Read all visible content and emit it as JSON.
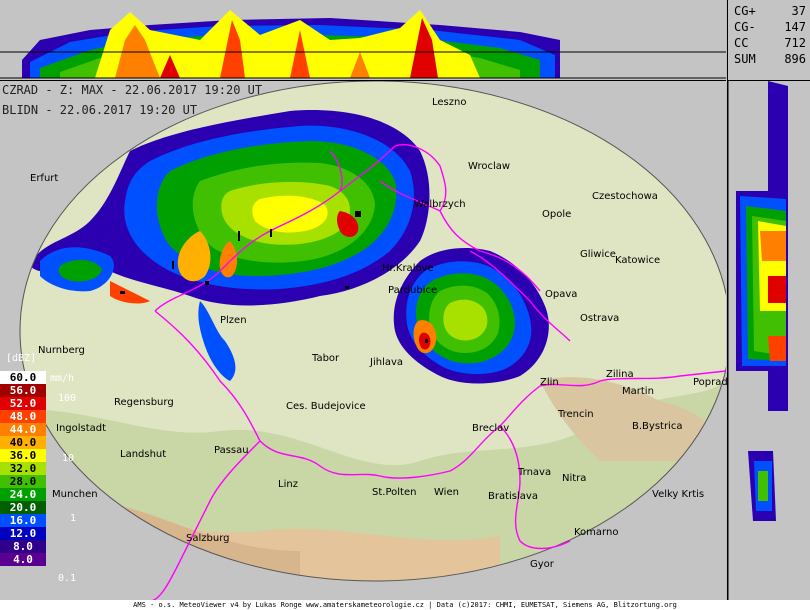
{
  "header": {
    "line1": "CZRAD - Z: MAX - 22.06.2017 19:20 UT",
    "line2": "BLIDN - 22.06.2017 19:20 UT"
  },
  "lightning_counts": [
    {
      "label": "CG+",
      "value": "37"
    },
    {
      "label": "CG-",
      "value": "147"
    },
    {
      "label": "CC",
      "value": "712"
    },
    {
      "label": "SUM",
      "value": "896"
    }
  ],
  "legend": {
    "title": "[dBZ]",
    "unit": "mm/h",
    "rows": [
      {
        "dbz": "60.0",
        "color": "#ffffff",
        "text_color": "#000000"
      },
      {
        "dbz": "56.0",
        "color": "#a00000",
        "text_color": "#ffffff"
      },
      {
        "dbz": "52.0",
        "color": "#e00000",
        "text_color": "#ffffff"
      },
      {
        "dbz": "48.0",
        "color": "#ff4000",
        "text_color": "#ffffff"
      },
      {
        "dbz": "44.0",
        "color": "#ff8000",
        "text_color": "#ffffff"
      },
      {
        "dbz": "40.0",
        "color": "#ffb000",
        "text_color": "#000000"
      },
      {
        "dbz": "36.0",
        "color": "#ffff00",
        "text_color": "#000000"
      },
      {
        "dbz": "32.0",
        "color": "#a8e000",
        "text_color": "#000000"
      },
      {
        "dbz": "28.0",
        "color": "#40c000",
        "text_color": "#000000"
      },
      {
        "dbz": "24.0",
        "color": "#00a000",
        "text_color": "#ffffff"
      },
      {
        "dbz": "20.0",
        "color": "#006000",
        "text_color": "#ffffff"
      },
      {
        "dbz": "16.0",
        "color": "#0050ff",
        "text_color": "#ffffff"
      },
      {
        "dbz": "12.0",
        "color": "#0000c0",
        "text_color": "#ffffff"
      },
      {
        "dbz": "8.0",
        "color": "#30008a",
        "text_color": "#ffffff"
      },
      {
        "dbz": "4.0",
        "color": "#5a0090",
        "text_color": "#ffffff"
      }
    ],
    "rates": [
      "100",
      "10",
      "1",
      "0.1"
    ]
  },
  "cities": [
    {
      "name": "Leszno"
    },
    {
      "name": "Wroclaw"
    },
    {
      "name": "Czestochowa"
    },
    {
      "name": "Opole"
    },
    {
      "name": "Gliwice"
    },
    {
      "name": "Katowice"
    },
    {
      "name": "Walbrzych"
    },
    {
      "name": "Hr.Kralove"
    },
    {
      "name": "Pardubice"
    },
    {
      "name": "Opava"
    },
    {
      "name": "Ostrava"
    },
    {
      "name": "Plzen"
    },
    {
      "name": "Tabor"
    },
    {
      "name": "Jihlava"
    },
    {
      "name": "Zlin"
    },
    {
      "name": "Zilina"
    },
    {
      "name": "Martin"
    },
    {
      "name": "Poprad"
    },
    {
      "name": "Nurnberg"
    },
    {
      "name": "Regensburg"
    },
    {
      "name": "Ces. Budejovice"
    },
    {
      "name": "Breclav"
    },
    {
      "name": "Trencin"
    },
    {
      "name": "B.Bystrica"
    },
    {
      "name": "Ingolstadt"
    },
    {
      "name": "Landshut"
    },
    {
      "name": "Passau"
    },
    {
      "name": "Trnava"
    },
    {
      "name": "Nitra"
    },
    {
      "name": "Linz"
    },
    {
      "name": "St.Polten"
    },
    {
      "name": "Wien"
    },
    {
      "name": "Bratislava"
    },
    {
      "name": "Velky Krtis"
    },
    {
      "name": "Munchen"
    },
    {
      "name": "Komarno"
    },
    {
      "name": "Salzburg"
    },
    {
      "name": "Gyor"
    },
    {
      "name": "Erfurt"
    }
  ],
  "footer": "AMS - o.s. MeteoViewer v4 by Lukas Ronge www.amaterskameteorologie.cz | Data (c)2017: CHMI, EUMETSAT, Siemens AG, Blitzortung.org"
}
